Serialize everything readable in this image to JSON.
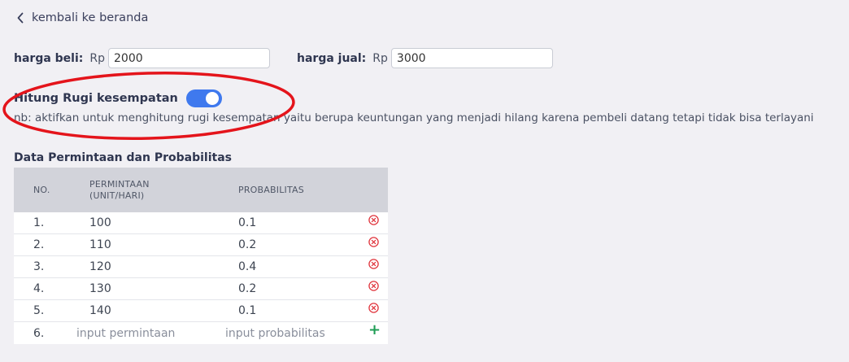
{
  "nav": {
    "back_label": "kembali ke beranda"
  },
  "prices": {
    "buy_label": "harga beli:",
    "buy_prefix": "Rp",
    "buy_value": "2000",
    "sell_label": "harga jual:",
    "sell_prefix": "Rp",
    "sell_value": "3000"
  },
  "opportunity": {
    "label": "Hitung Rugi kesempatan",
    "enabled": true,
    "note": "nb: aktifkan untuk menghitung rugi kesempatan yaitu berupa keuntungan yang menjadi hilang karena pembeli datang tetapi tidak bisa terlayani"
  },
  "table": {
    "title": "Data Permintaan dan Probabilitas",
    "headers": {
      "no": "NO.",
      "demand_line1": "PERMINTAAN",
      "demand_line2": "(UNIT/HARI)",
      "probability": "PROBABILITAS"
    },
    "rows": [
      {
        "no": "1.",
        "demand": "100",
        "probability": "0.1"
      },
      {
        "no": "2.",
        "demand": "110",
        "probability": "0.2"
      },
      {
        "no": "3.",
        "demand": "120",
        "probability": "0.4"
      },
      {
        "no": "4.",
        "demand": "130",
        "probability": "0.2"
      },
      {
        "no": "5.",
        "demand": "140",
        "probability": "0.1"
      }
    ],
    "new_row": {
      "no": "6.",
      "demand_placeholder": "input permintaan",
      "probability_placeholder": "input probabilitas",
      "add_symbol": "+"
    }
  },
  "colors": {
    "toggle_on": "#3f79ee",
    "delete": "#e0353d",
    "add": "#1f9d55",
    "annotation": "#e4141b"
  }
}
